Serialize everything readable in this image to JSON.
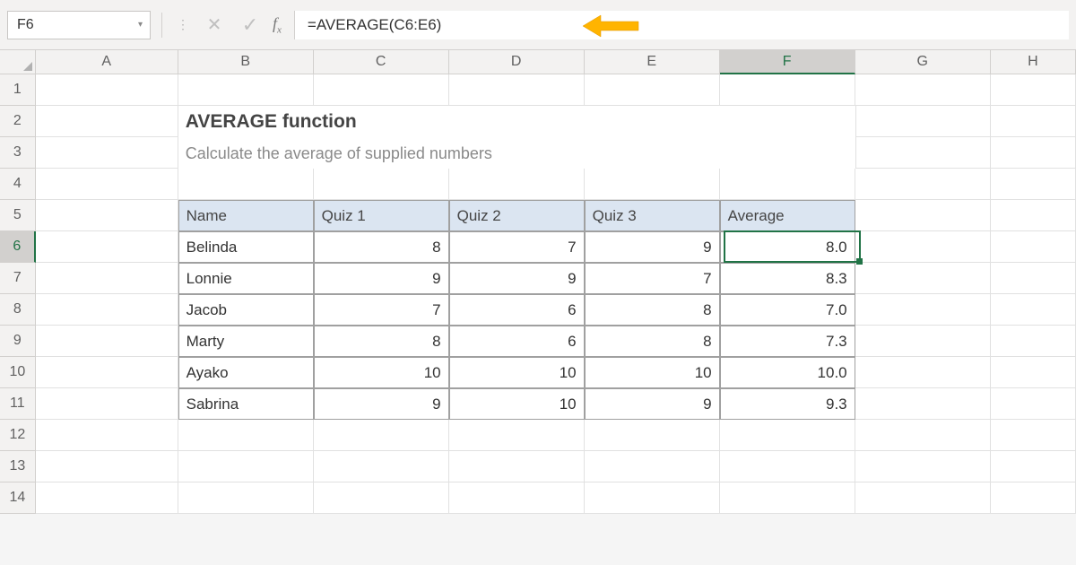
{
  "formula_bar": {
    "cell_ref": "F6",
    "formula": "=AVERAGE(C6:E6)"
  },
  "columns": [
    "A",
    "B",
    "C",
    "D",
    "E",
    "F",
    "G",
    "H"
  ],
  "active_column": "F",
  "row_numbers": [
    1,
    2,
    3,
    4,
    5,
    6,
    7,
    8,
    9,
    10,
    11,
    12,
    13,
    14
  ],
  "active_row": 6,
  "title": "AVERAGE function",
  "subtitle": "Calculate the average of supplied numbers",
  "table": {
    "headers": [
      "Name",
      "Quiz 1",
      "Quiz 2",
      "Quiz 3",
      "Average"
    ],
    "rows": [
      {
        "name": "Belinda",
        "q1": 8,
        "q2": 7,
        "q3": 9,
        "avg": "8.0"
      },
      {
        "name": "Lonnie",
        "q1": 9,
        "q2": 9,
        "q3": 7,
        "avg": "8.3"
      },
      {
        "name": "Jacob",
        "q1": 7,
        "q2": 6,
        "q3": 8,
        "avg": "7.0"
      },
      {
        "name": "Marty",
        "q1": 8,
        "q2": 6,
        "q3": 8,
        "avg": "7.3"
      },
      {
        "name": "Ayako",
        "q1": 10,
        "q2": 10,
        "q3": 10,
        "avg": "10.0"
      },
      {
        "name": "Sabrina",
        "q1": 9,
        "q2": 10,
        "q3": 9,
        "avg": "9.3"
      }
    ]
  },
  "chart_data": {
    "type": "table",
    "title": "AVERAGE function",
    "columns": [
      "Name",
      "Quiz 1",
      "Quiz 2",
      "Quiz 3",
      "Average"
    ],
    "rows": [
      [
        "Belinda",
        8,
        7,
        9,
        8.0
      ],
      [
        "Lonnie",
        9,
        9,
        7,
        8.3
      ],
      [
        "Jacob",
        7,
        6,
        8,
        7.0
      ],
      [
        "Marty",
        8,
        6,
        8,
        7.3
      ],
      [
        "Ayako",
        10,
        10,
        10,
        10.0
      ],
      [
        "Sabrina",
        9,
        10,
        9,
        9.3
      ]
    ]
  },
  "icons": {
    "cancel": "✕",
    "confirm": "✓",
    "caret": "▾"
  }
}
